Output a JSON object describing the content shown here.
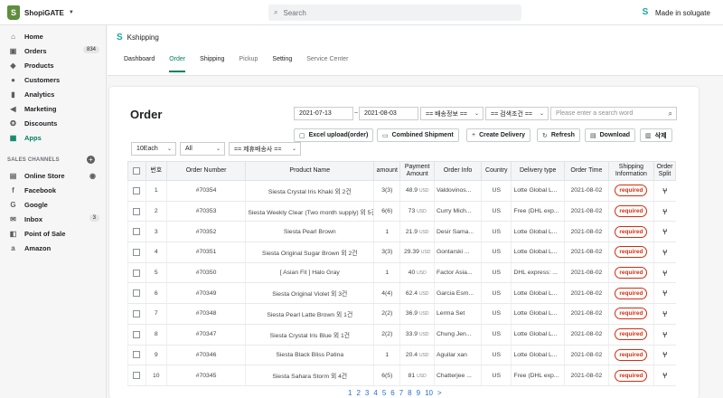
{
  "topbar": {
    "store_name": "ShopiGATE",
    "search_placeholder": "Search",
    "user_name": "Made in solugate"
  },
  "sidebar": {
    "items": [
      {
        "label": "Home",
        "icon": "home-icon"
      },
      {
        "label": "Orders",
        "icon": "orders-icon",
        "badge": "834"
      },
      {
        "label": "Products",
        "icon": "tag-icon"
      },
      {
        "label": "Customers",
        "icon": "person-icon"
      },
      {
        "label": "Analytics",
        "icon": "bar-chart-icon"
      },
      {
        "label": "Marketing",
        "icon": "megaphone-icon"
      },
      {
        "label": "Discounts",
        "icon": "discount-icon"
      },
      {
        "label": "Apps",
        "icon": "apps-icon"
      }
    ],
    "section_label": "SALES CHANNELS",
    "channels": [
      {
        "label": "Online Store",
        "icon": "store-icon"
      },
      {
        "label": "Facebook",
        "icon": "facebook-icon"
      },
      {
        "label": "Google",
        "icon": "google-icon"
      },
      {
        "label": "Inbox",
        "icon": "inbox-icon",
        "badge": "3"
      },
      {
        "label": "Point of Sale",
        "icon": "pos-icon"
      },
      {
        "label": "Amazon",
        "icon": "amazon-icon"
      }
    ]
  },
  "app": {
    "name": "Kshipping",
    "tabs": [
      "Dashboard",
      "Order",
      "Shipping",
      "Pickup",
      "Setting",
      "Service Center"
    ]
  },
  "order": {
    "title": "Order",
    "date_from": "2021-07-13",
    "date_sep": "~",
    "date_to": "2021-08-03",
    "delivery_filter": "== 배송정보 ==",
    "search_condition": "== 검색조건 ==",
    "search_placeholder": "Please enter a search word",
    "buttons": {
      "excel": "Excel upload(order)",
      "combined": "Combined Shipment",
      "create": "Create Delivery",
      "refresh": "Refresh",
      "download": "Download",
      "delete": "삭제"
    },
    "per_page": "10Each",
    "status_filter": "All",
    "carrier_filter": "== 제휴배송사 =="
  },
  "table": {
    "headers": {
      "no": "번호",
      "order_number": "Order Number",
      "product": "Product Name",
      "amount": "amount",
      "payment1": "Payment",
      "payment2": "Amount",
      "info": "Order Info",
      "country": "Country",
      "delivery": "Delivery type",
      "time": "Order Time",
      "ship1": "Shipping",
      "ship2": "Information",
      "split1": "Order",
      "split2": "Split"
    },
    "required_label": "required",
    "currency": "USD",
    "rows": [
      {
        "no": "1",
        "order": "#70354",
        "product": "Siesta Crystal Iris Khaki 외 2건",
        "amount": "3(3)",
        "payment": "48.9",
        "info": "Valdovinos...",
        "country": "US",
        "delivery": "Lotte Global L...",
        "time": "2021-08-02"
      },
      {
        "no": "2",
        "order": "#70353",
        "product": "Siesta Weekly Clear (Two month supply) 외 5건",
        "amount": "6(6)",
        "payment": "73",
        "info": "Curry Mich...",
        "country": "US",
        "delivery": "Free (DHL exp...",
        "time": "2021-08-02"
      },
      {
        "no": "3",
        "order": "#70352",
        "product": "Siesta Pearl Brown",
        "amount": "1",
        "payment": "21.9",
        "info": "Desir Sama...",
        "country": "US",
        "delivery": "Lotte Global L...",
        "time": "2021-08-02"
      },
      {
        "no": "4",
        "order": "#70351",
        "product": "Siesta Original Sugar Brown 외 2건",
        "amount": "3(3)",
        "payment": "29.39",
        "info": "Gontarski ...",
        "country": "US",
        "delivery": "Lotte Global L...",
        "time": "2021-08-02"
      },
      {
        "no": "5",
        "order": "#70350",
        "product": "[ Asian Fit ] Halo Gray",
        "amount": "1",
        "payment": "40",
        "info": "Factor Asia...",
        "country": "US",
        "delivery": "DHL express: ...",
        "time": "2021-08-02"
      },
      {
        "no": "6",
        "order": "#70349",
        "product": "Siesta Original Violet 외 3건",
        "amount": "4(4)",
        "payment": "62.4",
        "info": "Garcia Esm...",
        "country": "US",
        "delivery": "Lotte Global L...",
        "time": "2021-08-02"
      },
      {
        "no": "7",
        "order": "#70348",
        "product": "Siesta Pearl Latte Brown 외 1건",
        "amount": "2(2)",
        "payment": "36.9",
        "info": "Lerma Set",
        "country": "US",
        "delivery": "Lotte Global L...",
        "time": "2021-08-02"
      },
      {
        "no": "8",
        "order": "#70347",
        "product": "Siesta Crystal Iris Blue 외 1건",
        "amount": "2(2)",
        "payment": "33.9",
        "info": "Chung Jen...",
        "country": "US",
        "delivery": "Lotte Global L...",
        "time": "2021-08-02"
      },
      {
        "no": "9",
        "order": "#70346",
        "product": "Siesta Black Bliss Patina",
        "amount": "1",
        "payment": "20.4",
        "info": "Aguilar xan",
        "country": "US",
        "delivery": "Lotte Global L...",
        "time": "2021-08-02"
      },
      {
        "no": "10",
        "order": "#70345",
        "product": "Siesta Sahara Storm 외 4건",
        "amount": "6(5)",
        "payment": "81",
        "info": "Chatterjee ...",
        "country": "US",
        "delivery": "Free (DHL exp...",
        "time": "2021-08-02"
      }
    ]
  },
  "pagination": {
    "pages": [
      "1",
      "2",
      "3",
      "4",
      "5",
      "6",
      "7",
      "8",
      "9",
      "10"
    ],
    "next": ">"
  },
  "colors": {
    "accent": "#008060",
    "required": "#d72c0d",
    "link": "#2c6ecb"
  }
}
